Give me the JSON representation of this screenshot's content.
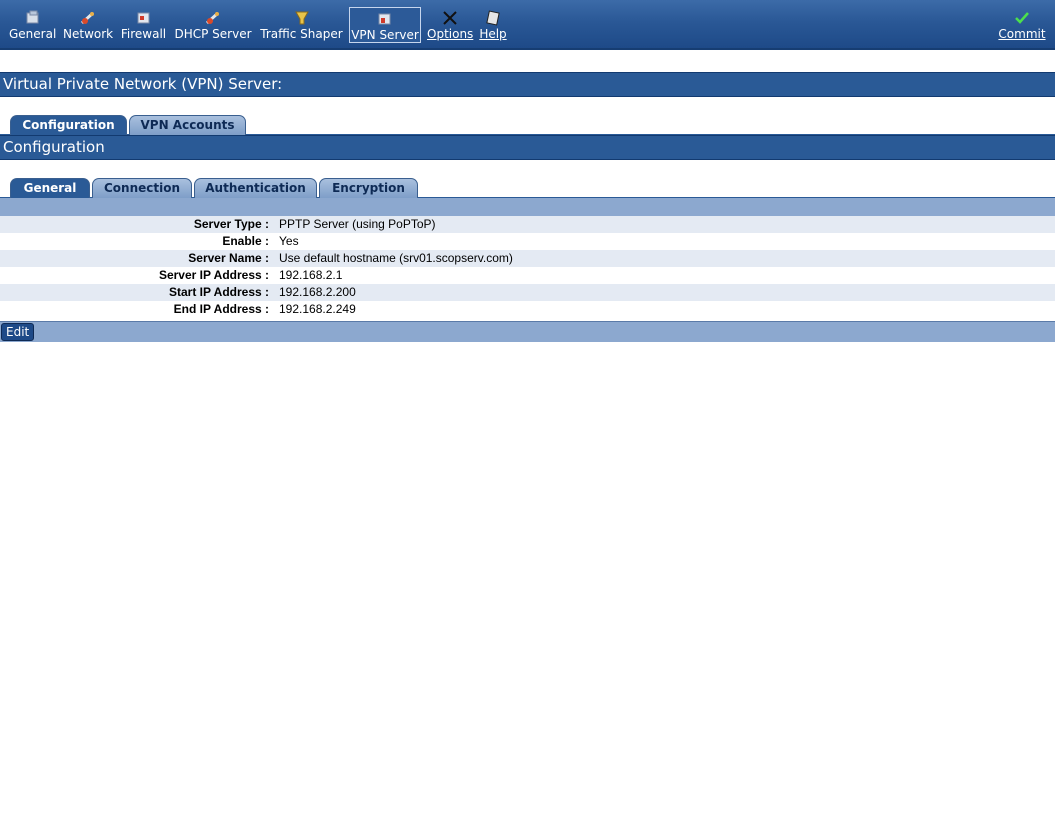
{
  "toolbar": {
    "items": [
      {
        "label": "General",
        "icon": "general-icon"
      },
      {
        "label": "Network",
        "icon": "network-icon"
      },
      {
        "label": "Firewall",
        "icon": "firewall-icon"
      },
      {
        "label": "DHCP Server",
        "icon": "dhcp-icon"
      },
      {
        "label": "Traffic Shaper",
        "icon": "traffic-shaper-icon"
      },
      {
        "label": "VPN Server",
        "icon": "vpn-server-icon"
      },
      {
        "label": "Options",
        "icon": "options-icon"
      },
      {
        "label": "Help",
        "icon": "help-icon"
      },
      {
        "label": "Commit",
        "icon": "check-icon"
      }
    ],
    "active": "VPN Server"
  },
  "page": {
    "title": "Virtual Private Network (VPN) Server:",
    "top_tabs": [
      "Configuration",
      "VPN Accounts"
    ],
    "section_title": "Configuration",
    "sub_tabs": [
      "General",
      "Connection",
      "Authentication",
      "Encryption"
    ]
  },
  "details": [
    {
      "label": "Server Type :",
      "value": "PPTP Server (using PoPToP)"
    },
    {
      "label": "Enable :",
      "value": "Yes"
    },
    {
      "label": "Server Name :",
      "value": "Use default hostname (srv01.scopserv.com)"
    },
    {
      "label": "Server IP Address :",
      "value": "192.168.2.1"
    },
    {
      "label": "Start IP Address :",
      "value": "192.168.2.200"
    },
    {
      "label": "End IP Address :",
      "value": "192.168.2.249"
    }
  ],
  "actions": {
    "edit_label": "Edit"
  },
  "colors": {
    "header": "#2a5a96",
    "toolbar": "#2a5896",
    "strip": "#8ca8cf",
    "alt_row": "#e4eaf3"
  }
}
